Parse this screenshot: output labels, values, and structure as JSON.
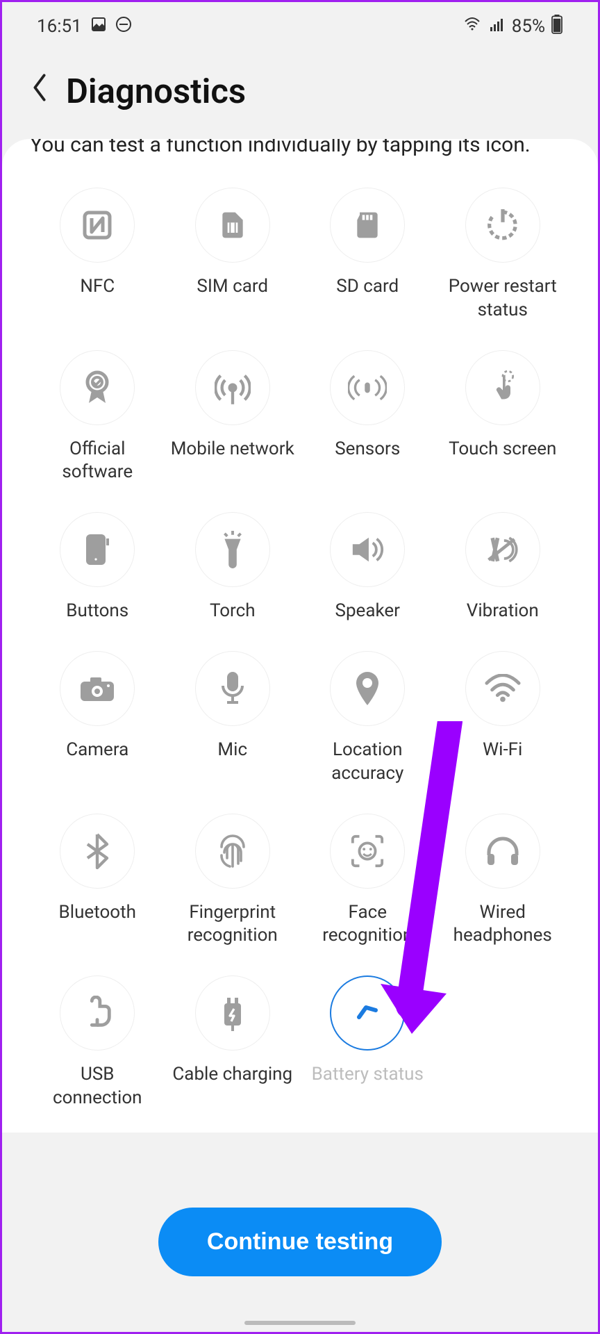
{
  "status": {
    "time": "16:51",
    "battery_pct": "85%"
  },
  "header": {
    "title": "Diagnostics"
  },
  "description": "You can test a function individually by tapping its icon.",
  "items": [
    {
      "id": "nfc",
      "label": "NFC"
    },
    {
      "id": "sim-card",
      "label": "SIM card"
    },
    {
      "id": "sd-card",
      "label": "SD card"
    },
    {
      "id": "power-restart",
      "label": "Power restart status"
    },
    {
      "id": "official-software",
      "label": "Official software"
    },
    {
      "id": "mobile-network",
      "label": "Mobile network"
    },
    {
      "id": "sensors",
      "label": "Sensors"
    },
    {
      "id": "touch-screen",
      "label": "Touch screen"
    },
    {
      "id": "buttons",
      "label": "Buttons"
    },
    {
      "id": "torch",
      "label": "Torch"
    },
    {
      "id": "speaker",
      "label": "Speaker"
    },
    {
      "id": "vibration",
      "label": "Vibration"
    },
    {
      "id": "camera",
      "label": "Camera"
    },
    {
      "id": "mic",
      "label": "Mic"
    },
    {
      "id": "location",
      "label": "Location accuracy"
    },
    {
      "id": "wifi",
      "label": "Wi-Fi"
    },
    {
      "id": "bluetooth",
      "label": "Bluetooth"
    },
    {
      "id": "fingerprint",
      "label": "Fingerprint recognition"
    },
    {
      "id": "face",
      "label": "Face recognition"
    },
    {
      "id": "headphones",
      "label": "Wired headphones"
    },
    {
      "id": "usb",
      "label": "USB connection"
    },
    {
      "id": "cable-charging",
      "label": "Cable charging"
    },
    {
      "id": "battery-status",
      "label": "Battery status",
      "completed": true
    }
  ],
  "cta": {
    "label": "Continue testing"
  },
  "colors": {
    "accent": "#0b8cf5",
    "icon": "#9e9e9e",
    "annotation": "#9a00ff"
  }
}
